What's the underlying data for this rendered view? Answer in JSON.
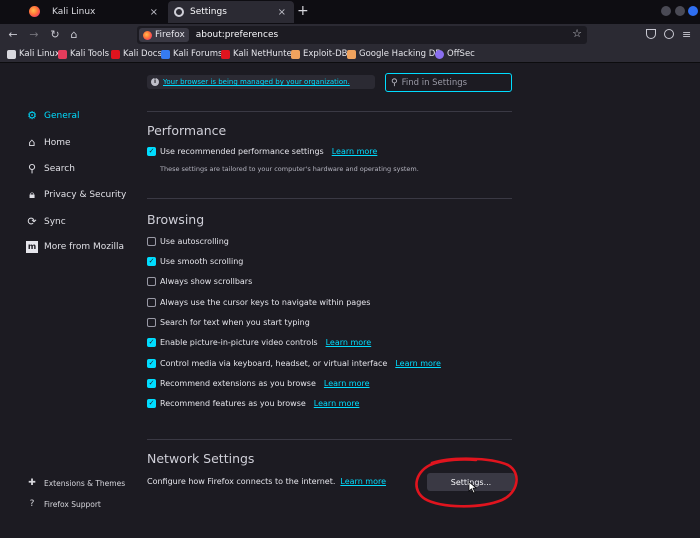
{
  "tabs": [
    {
      "title": "Kali Linux",
      "close": "×"
    },
    {
      "title": "Settings",
      "close": "×"
    }
  ],
  "new_tab": "+",
  "nav": {
    "back": "←",
    "forward": "→",
    "reload": "↻",
    "home": "⌂",
    "identity_label": "Firefox",
    "url": "about:preferences",
    "star": "☆"
  },
  "bookmarks": [
    {
      "label": "Kali Linux",
      "color": "#ffffff"
    },
    {
      "label": "Kali Tools",
      "color": "#e43c5c"
    },
    {
      "label": "Kali Docs",
      "color": "#e0141e"
    },
    {
      "label": "Kali Forums",
      "color": "#367bf0"
    },
    {
      "label": "Kali NetHunter",
      "color": "#e0141e"
    },
    {
      "label": "Exploit-DB",
      "color": "#f0a35e"
    },
    {
      "label": "Google Hacking DB",
      "color": "#f0a35e"
    },
    {
      "label": "OffSec",
      "color": "#8a6ff0"
    }
  ],
  "sidebar": {
    "categories": [
      {
        "label": "General",
        "icon": "gear-icon"
      },
      {
        "label": "Home",
        "icon": "home-icon"
      },
      {
        "label": "Search",
        "icon": "search-icon"
      },
      {
        "label": "Privacy & Security",
        "icon": "lock-icon"
      },
      {
        "label": "Sync",
        "icon": "sync-icon"
      },
      {
        "label": "More from Mozilla",
        "icon": "mozilla-icon"
      }
    ],
    "footer": [
      {
        "label": "Extensions & Themes",
        "icon": "puzzle-icon"
      },
      {
        "label": "Firefox Support",
        "icon": "help-icon"
      }
    ]
  },
  "notice": "Your browser is being managed by your organization.",
  "find": {
    "placeholder": "Find in Settings"
  },
  "performance": {
    "title": "Performance",
    "use_recommended": {
      "label": "Use recommended performance settings",
      "checked": true,
      "learn_more": "Learn more"
    },
    "description": "These settings are tailored to your computer's hardware and operating system."
  },
  "browsing": {
    "title": "Browsing",
    "options": [
      {
        "label": "Use autoscrolling",
        "checked": false
      },
      {
        "label": "Use smooth scrolling",
        "checked": true
      },
      {
        "label": "Always show scrollbars",
        "checked": false
      },
      {
        "label": "Always use the cursor keys to navigate within pages",
        "checked": false
      },
      {
        "label": "Search for text when you start typing",
        "checked": false
      },
      {
        "label": "Enable picture-in-picture video controls",
        "checked": true,
        "learn_more": "Learn more"
      },
      {
        "label": "Control media via keyboard, headset, or virtual interface",
        "checked": true,
        "learn_more": "Learn more"
      },
      {
        "label": "Recommend extensions as you browse",
        "checked": true,
        "learn_more": "Learn more"
      },
      {
        "label": "Recommend features as you browse",
        "checked": true,
        "learn_more": "Learn more"
      }
    ]
  },
  "network": {
    "title": "Network Settings",
    "description": "Configure how Firefox connects to the internet.",
    "learn_more": "Learn more",
    "button": "Settings..."
  },
  "colors": {
    "accent": "#00ddff",
    "annotation": "#e0141e",
    "background": "#1c1b22"
  }
}
